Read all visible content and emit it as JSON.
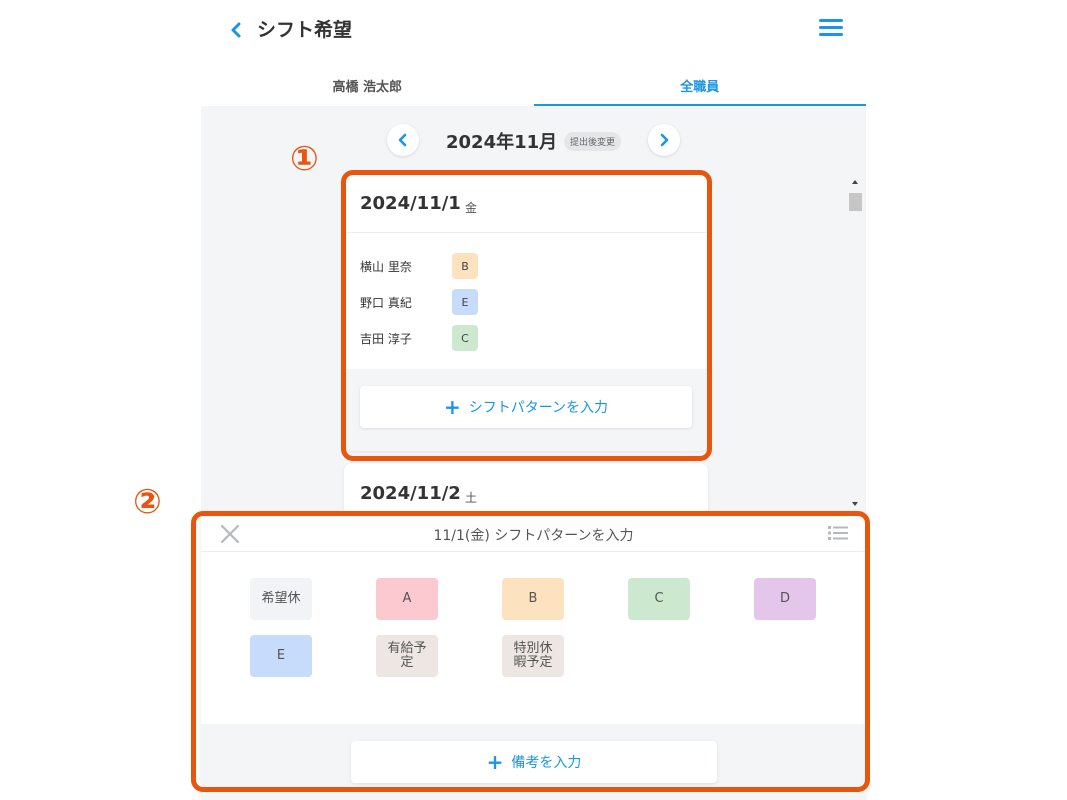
{
  "header": {
    "title": "シフト希望",
    "back_icon": "chevron-left-icon",
    "menu_icon": "hamburger-menu-icon"
  },
  "tabs": [
    {
      "label": "高橋 浩太郎",
      "active": false
    },
    {
      "label": "全職員",
      "active": true
    }
  ],
  "month_nav": {
    "label": "2024年11月",
    "badge": "提出後変更"
  },
  "days": [
    {
      "date": "2024/11/1",
      "dow": "金",
      "members": [
        {
          "name": "横山 里奈",
          "pattern": "B",
          "color": "#fde2bf"
        },
        {
          "name": "野口 真紀",
          "pattern": "E",
          "color": "#c6dcfa"
        },
        {
          "name": "吉田 淳子",
          "pattern": "C",
          "color": "#cce8cf"
        }
      ],
      "add_pattern_label": "シフトパターンを入力"
    },
    {
      "date": "2024/11/2",
      "dow": "土"
    }
  ],
  "sheet": {
    "title": "11/1(金) シフトパターンを入力",
    "patterns": [
      {
        "label": "希望休",
        "color": "#f2f3f6"
      },
      {
        "label": "A",
        "color": "#fbc9cf"
      },
      {
        "label": "B",
        "color": "#fde2bf"
      },
      {
        "label": "C",
        "color": "#cce8cf"
      },
      {
        "label": "D",
        "color": "#e3c6ea"
      },
      {
        "label": "E",
        "color": "#c6dcfa"
      },
      {
        "label": "有給予定",
        "color": "#ede6e3"
      },
      {
        "label": "特別休暇予定",
        "color": "#ede6e3"
      }
    ],
    "memo_label": "備考を入力"
  },
  "annotations": [
    "①",
    "②"
  ],
  "colors": {
    "accent": "#1a96e6",
    "annotation": "#e8550f"
  }
}
